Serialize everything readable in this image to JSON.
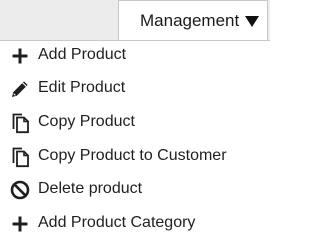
{
  "management": {
    "label": "Management",
    "caret_icon": "caret-down-icon"
  },
  "menu": {
    "items": [
      {
        "label": "Add Product",
        "icon": "plus-icon"
      },
      {
        "label": "Edit Product",
        "icon": "pencil-icon"
      },
      {
        "label": "Copy Product",
        "icon": "copy-icon"
      },
      {
        "label": "Copy Product to Customer",
        "icon": "copy-icon"
      },
      {
        "label": "Delete product",
        "icon": "prohibited-icon"
      },
      {
        "label": "Add Product Category",
        "icon": "plus-icon"
      }
    ]
  },
  "colors": {
    "text": "#1f1f1f",
    "topbar_background": "#ececec",
    "border": "#c8c8c8"
  }
}
